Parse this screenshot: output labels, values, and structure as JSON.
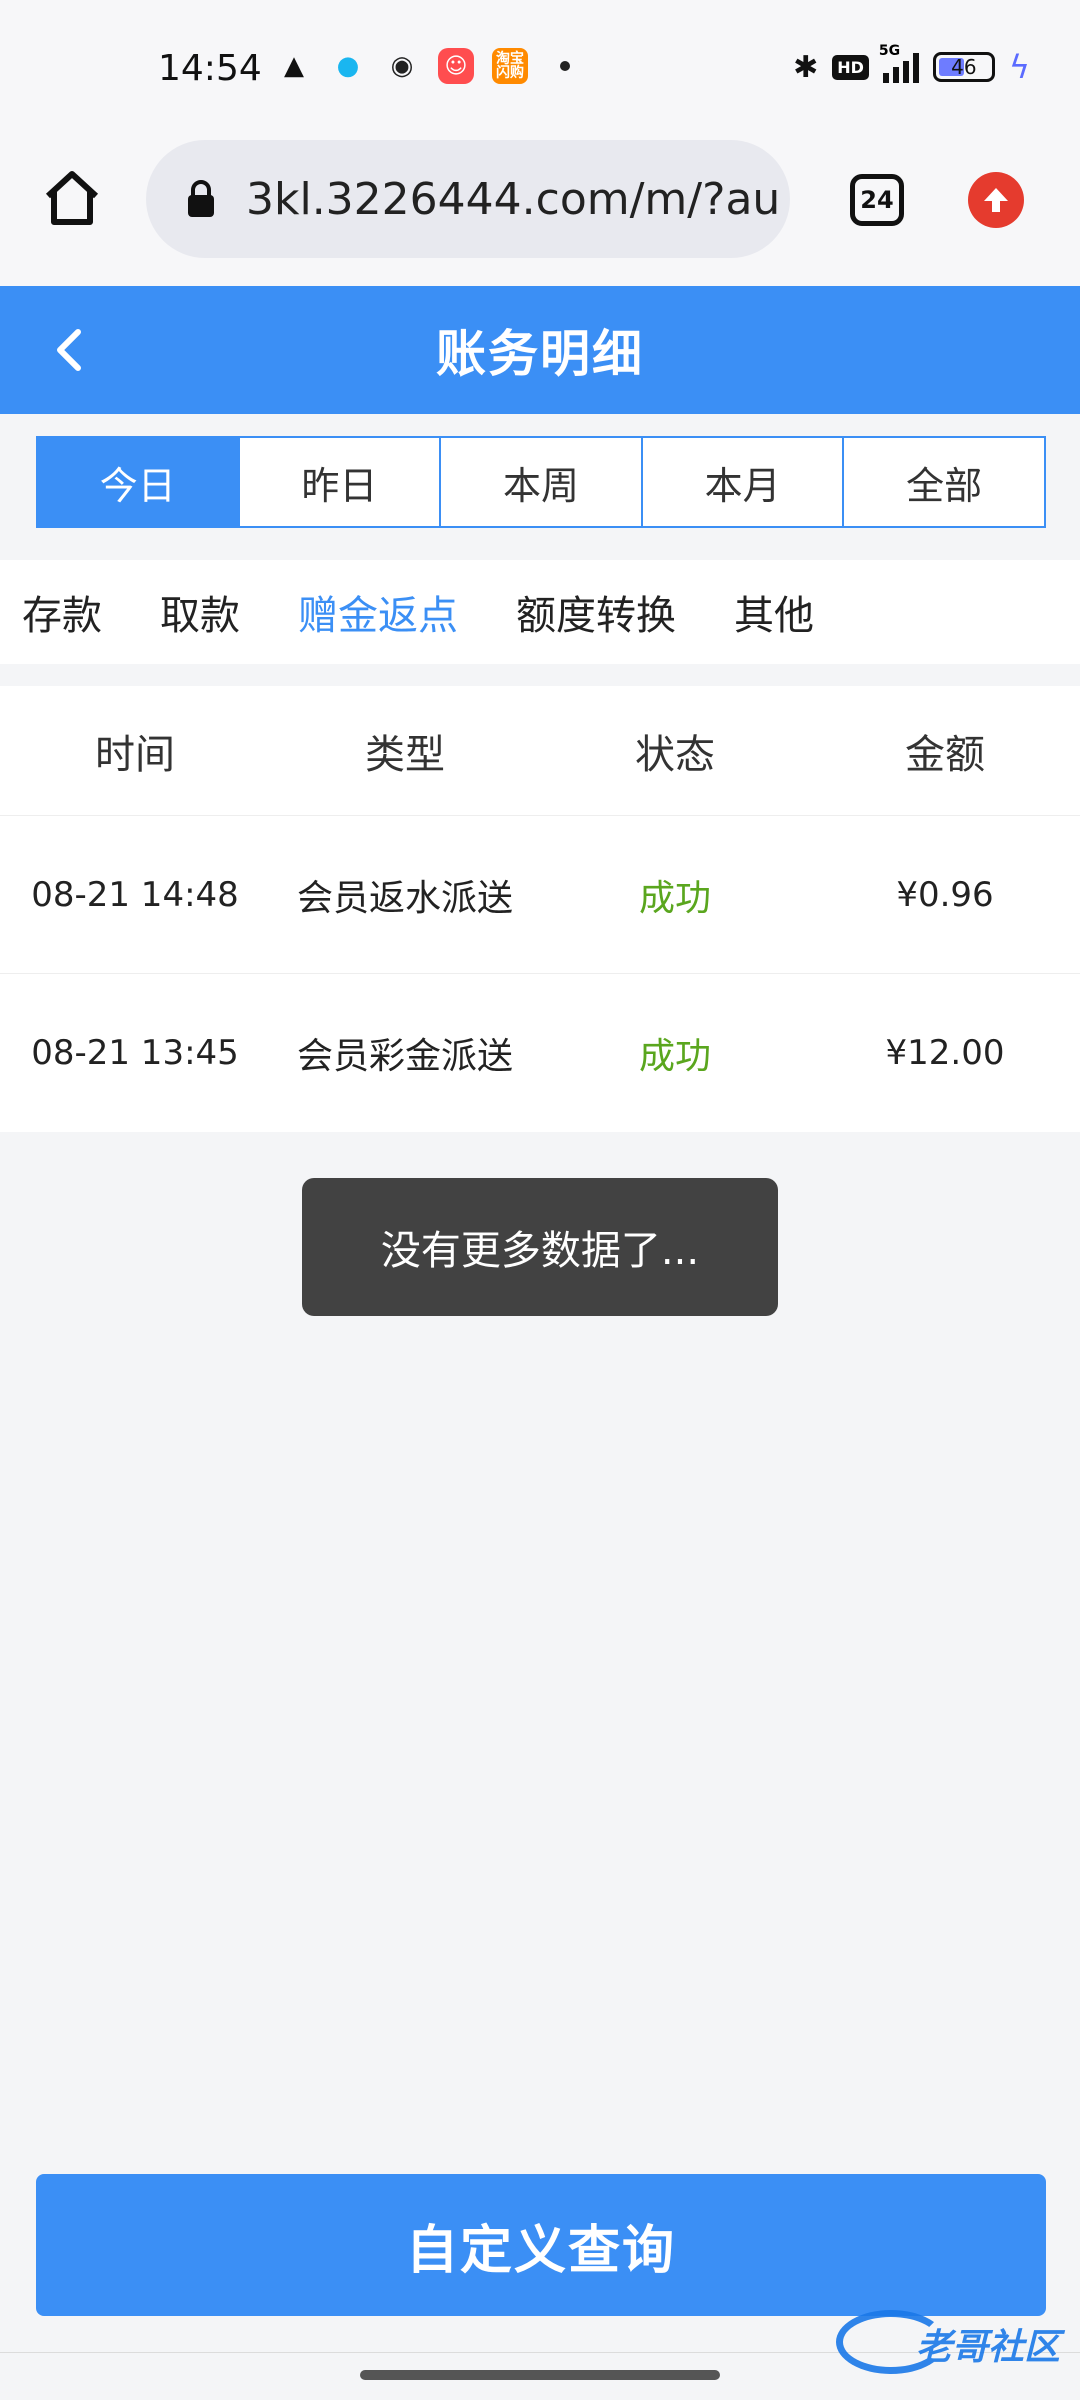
{
  "status_bar": {
    "time": "14:54",
    "battery": "46",
    "network": "5G",
    "hd": "HD",
    "taobao_label": "淘宝闪购"
  },
  "browser": {
    "url": "3kl.3226444.com/m/?au",
    "tab_count": "24"
  },
  "header": {
    "title": "账务明细"
  },
  "period_tabs": [
    {
      "label": "今日",
      "active": true
    },
    {
      "label": "昨日",
      "active": false
    },
    {
      "label": "本周",
      "active": false
    },
    {
      "label": "本月",
      "active": false
    },
    {
      "label": "全部",
      "active": false
    }
  ],
  "category_tabs": [
    {
      "label": "存款",
      "active": false
    },
    {
      "label": "取款",
      "active": false
    },
    {
      "label": "赠金返点",
      "active": true
    },
    {
      "label": "额度转换",
      "active": false
    },
    {
      "label": "其他",
      "active": false
    }
  ],
  "table": {
    "headers": [
      "时间",
      "类型",
      "状态",
      "金额"
    ],
    "rows": [
      {
        "time": "08-21 14:48",
        "type": "会员返水派送",
        "status": "成功",
        "amount": "¥0.96"
      },
      {
        "time": "08-21 13:45",
        "type": "会员彩金派送",
        "status": "成功",
        "amount": "¥12.00"
      }
    ]
  },
  "toast": {
    "message": "没有更多数据了..."
  },
  "query_button": {
    "label": "自定义查询"
  },
  "watermark": {
    "text": "老哥社区"
  },
  "colors": {
    "primary": "#3b8ff5",
    "success": "#5aa61e",
    "toast_bg": "#424242",
    "update_red": "#e53b2e"
  }
}
